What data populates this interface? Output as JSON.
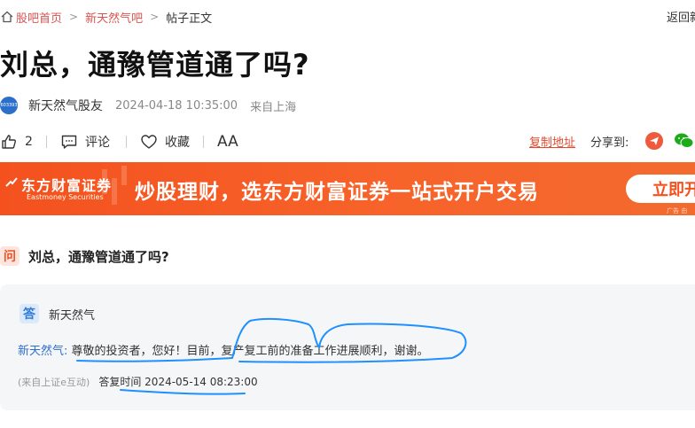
{
  "breadcrumb": {
    "items": [
      "股吧首页",
      "新天然气吧",
      "帖子正文"
    ],
    "back": "返回新"
  },
  "post": {
    "title": "刘总，通豫管道通了吗?",
    "avatar_text": "603393",
    "author": "新天然气股友",
    "time": "2024-04-18 10:35:00",
    "location": "来自上海"
  },
  "actions": {
    "like_count": "2",
    "comment": "评论",
    "favorite": "收藏",
    "font": "AA",
    "copy_link": "复制地址",
    "share": "分享到:"
  },
  "banner": {
    "brand_cn": "东方财富证券",
    "brand_en": "Eastmoney Securities",
    "slogan": "炒股理财，选东方财富证券一站式开户交易",
    "cta": "立即开",
    "ad_tag": "广告 由"
  },
  "qa": {
    "q_badge": "问",
    "question": "刘总，通豫管道通了吗?",
    "a_badge": "答",
    "company": "新天然气",
    "answer_who": "新天然气:",
    "answer_text": "尊敬的投资者，您好！目前，复产复工前的准备工作进展顺利，谢谢。",
    "source": "(来自上证e互动)",
    "reply_time": "答复时间 2024-05-14 08:23:00"
  },
  "colors": {
    "accent": "#e04a2f",
    "banner": "#f4511e",
    "link_blue": "#2f6fcf",
    "annotation": "#1e90ff"
  }
}
